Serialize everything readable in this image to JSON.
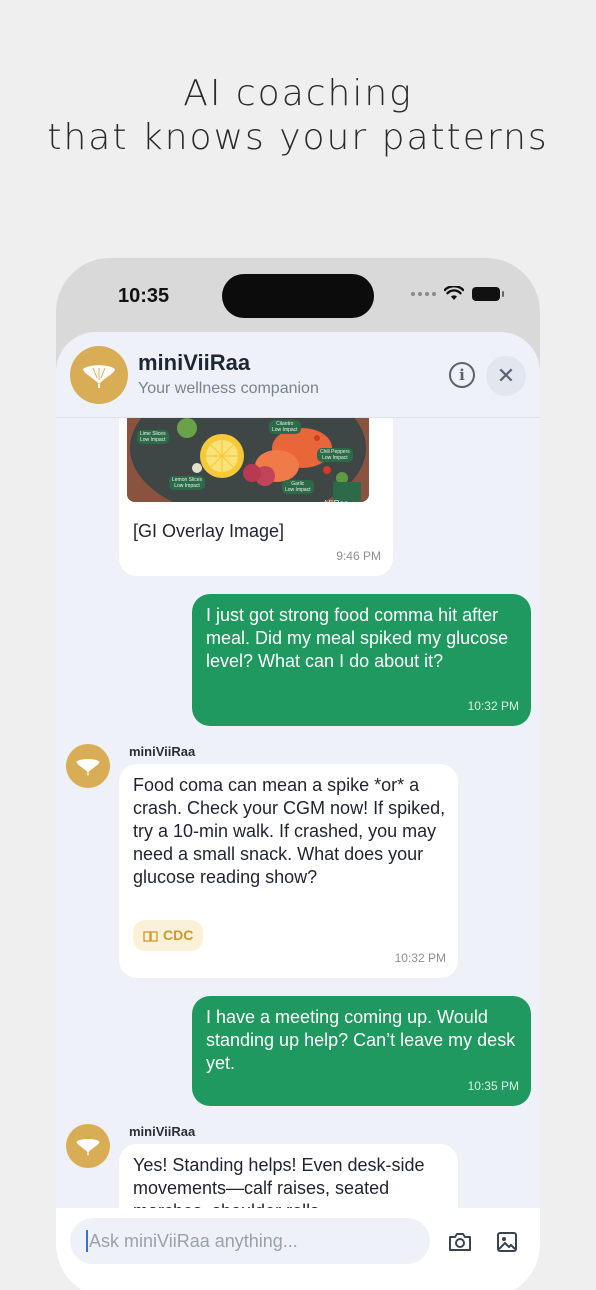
{
  "promo": {
    "line1": "AI coaching",
    "line2": "that knows your patterns"
  },
  "status_bar": {
    "time": "10:35"
  },
  "chat_header": {
    "title": "miniViiRaa",
    "subtitle": "Your wellness companion"
  },
  "messages": {
    "m1": {
      "image_alt": "[GI Overlay Image]",
      "image_tags": [
        "Lime Slices",
        "Cilantro",
        "Chili Peppers",
        "Lemon Slices",
        "Garlic"
      ],
      "image_tag_sub": "Low Impact",
      "image_brand": "ViiRaa",
      "time": "9:46 PM"
    },
    "m2": {
      "text": "I just got strong food comma hit after meal. Did my meal spiked my glucose level? What can I do about it?",
      "time": "10:32 PM"
    },
    "m3": {
      "sender": "miniViiRaa",
      "text": "Food coma can mean a spike *or* a crash. Check your CGM now! If spiked, try a 10-min walk. If crashed, you may need a small snack. What does your glucose reading show?",
      "source": "CDC",
      "time": "10:32 PM"
    },
    "m4": {
      "text": "I have a meeting coming up. Would standing up help? Can’t leave my desk yet.",
      "time": "10:35 PM"
    },
    "m5": {
      "sender": "miniViiRaa",
      "text": "Yes! Standing helps! Even desk-side movements—calf raises, seated marches, shoulder rolls"
    }
  },
  "input": {
    "placeholder": "Ask miniViiRaa anything..."
  },
  "colors": {
    "accent_green": "#1f9960",
    "avatar_gold": "#d9ad55",
    "chat_bg": "#eef2f8"
  },
  "icons": [
    "ginkgo-leaf-icon",
    "info-icon",
    "close-icon",
    "camera-icon",
    "image-icon",
    "book-icon",
    "wifi-icon",
    "battery-icon"
  ]
}
